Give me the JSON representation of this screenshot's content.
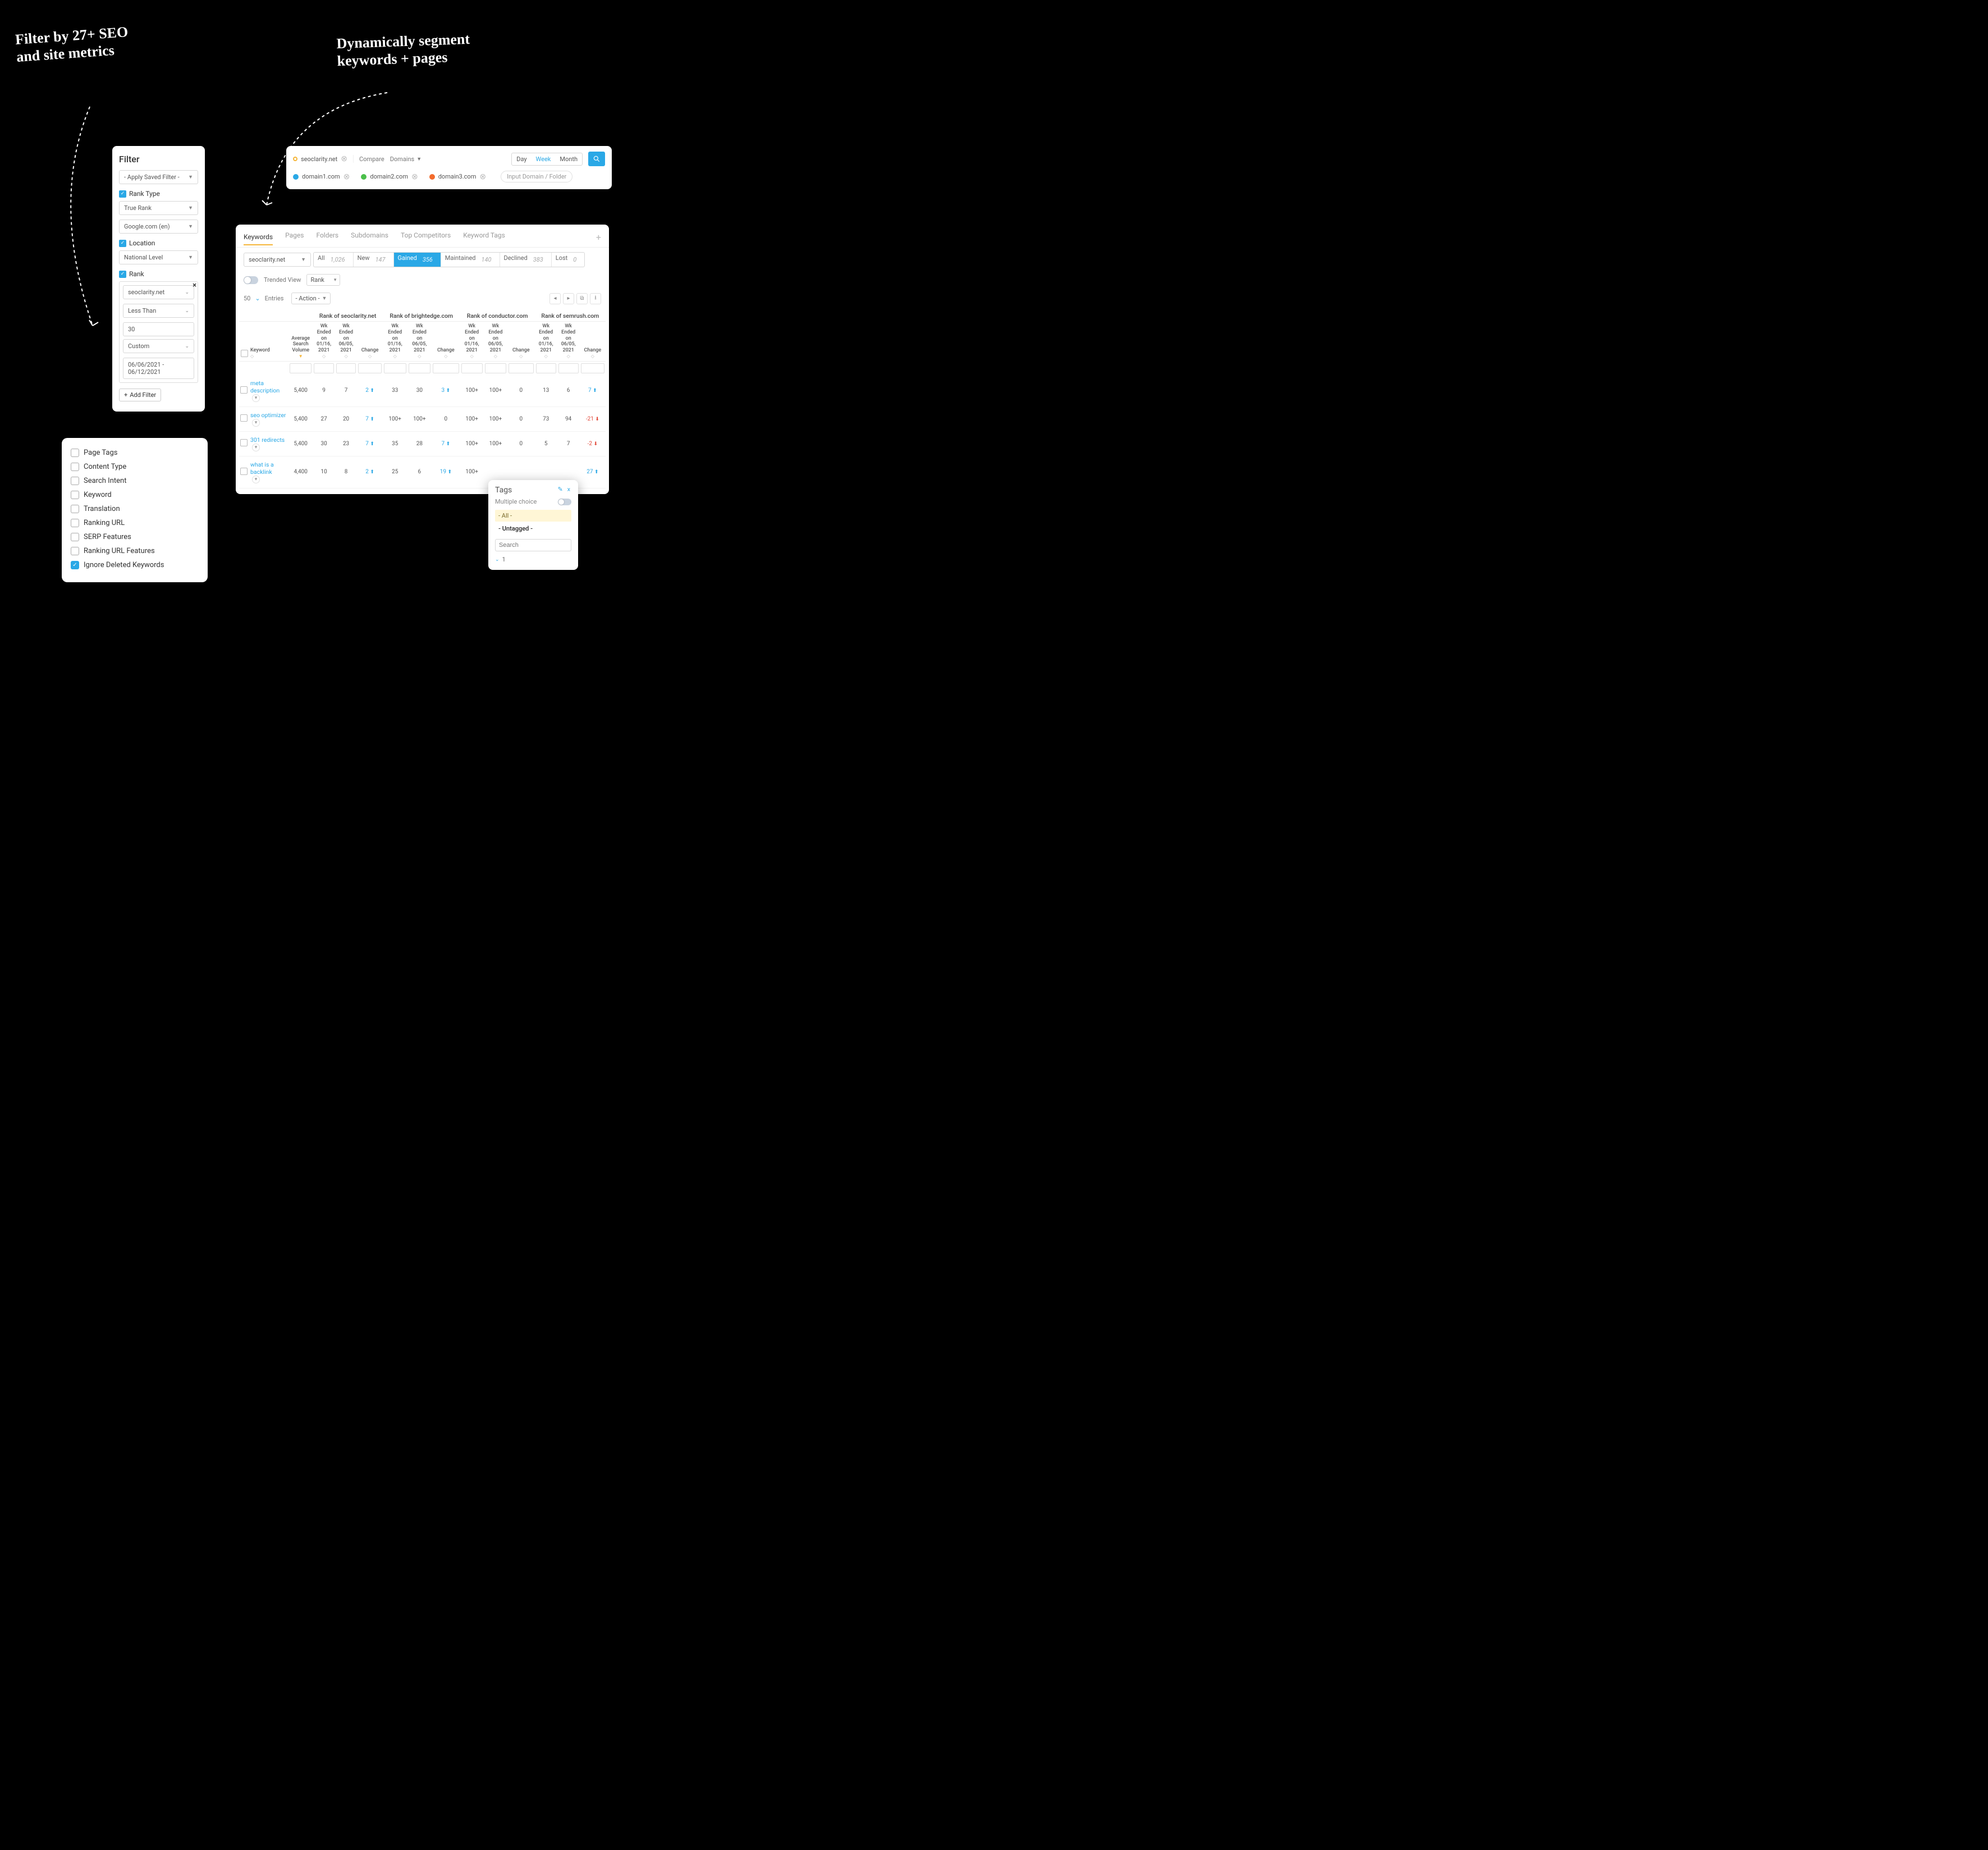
{
  "annotations": {
    "left": "Filter by 27+ SEO\nand site metrics",
    "right": "Dynamically segment\nkeywords + pages"
  },
  "filter_panel": {
    "title": "Filter",
    "apply_saved": "- Apply Saved Filter -",
    "rank_type_label": "Rank Type",
    "rank_type_value": "True Rank",
    "engine_value": "Google.com (en)",
    "location_label": "Location",
    "location_value": "National Level",
    "rank_label": "Rank",
    "rank_domain": "seoclarity.net",
    "rank_op": "Less Than",
    "rank_value": "30",
    "rank_range_type": "Custom",
    "rank_daterange": "06/06/2021 - 06/12/2021",
    "add_filter": "Add Filter"
  },
  "checklist": {
    "items": [
      {
        "label": "Page Tags",
        "checked": false
      },
      {
        "label": "Content Type",
        "checked": false
      },
      {
        "label": "Search Intent",
        "checked": false
      },
      {
        "label": "Keyword",
        "checked": false
      },
      {
        "label": "Translation",
        "checked": false
      },
      {
        "label": "Ranking URL",
        "checked": false
      },
      {
        "label": "SERP Features",
        "checked": false
      },
      {
        "label": "Ranking URL Features",
        "checked": false
      },
      {
        "label": "Ignore Deleted Keywords",
        "checked": true
      }
    ]
  },
  "searchbar": {
    "primary_domain": "seoclarity.net",
    "compare_label": "Compare",
    "domains_label": "Domains",
    "time": {
      "day": "Day",
      "week": "Week",
      "month": "Month"
    },
    "compare_domains": [
      {
        "name": "domain1.com",
        "color": "#2aa8e6"
      },
      {
        "name": "domain2.com",
        "color": "#4bbf4b"
      },
      {
        "name": "domain3.com",
        "color": "#f36b2c"
      }
    ],
    "input_placeholder": "Input Domain / Folder"
  },
  "results": {
    "tabs": [
      "Keywords",
      "Pages",
      "Folders",
      "Subdomains",
      "Top Competitors",
      "Keyword Tags"
    ],
    "active_tab": 0,
    "domain_select": "seoclarity.net",
    "status_pills": [
      {
        "label": "All",
        "count": "1,026"
      },
      {
        "label": "New",
        "count": "147"
      },
      {
        "label": "Gained",
        "count": "356"
      },
      {
        "label": "Maintained",
        "count": "140"
      },
      {
        "label": "Declined",
        "count": "383"
      },
      {
        "label": "Lost",
        "count": "0"
      }
    ],
    "active_pill": 2,
    "trended_label": "Trended View",
    "rank_select": "Rank",
    "entries_count": "50",
    "entries_label": "Entries",
    "action_label": "- Action -",
    "group_headers": [
      "Rank of seoclarity.net",
      "Rank of brightedge.com",
      "Rank of conductor.com",
      "Rank of semrush.com"
    ],
    "kw_header": "Keyword",
    "avg_header": "Average\nSearch\nVolume",
    "wk1_header": "Wk\nEnded\non\n01/16,\n2021",
    "wk2_header": "Wk\nEnded\non\n06/05,\n2021",
    "change_header": "Change",
    "rows": [
      {
        "kw": "meta description",
        "vol": "5,400",
        "a1": "9",
        "a2": "7",
        "ac": "2",
        "acd": "up",
        "b1": "33",
        "b2": "30",
        "bc": "3",
        "bcd": "up",
        "c1": "100+",
        "c2": "100+",
        "cc": "0",
        "ccd": "",
        "d1": "13",
        "d2": "6",
        "dc": "7",
        "dcd": "up"
      },
      {
        "kw": "seo optimizer",
        "vol": "5,400",
        "a1": "27",
        "a2": "20",
        "ac": "7",
        "acd": "up",
        "b1": "100+",
        "b2": "100+",
        "bc": "0",
        "bcd": "",
        "c1": "100+",
        "c2": "100+",
        "cc": "0",
        "ccd": "",
        "d1": "73",
        "d2": "94",
        "dc": "-21",
        "dcd": "down"
      },
      {
        "kw": "301 redirects",
        "vol": "5,400",
        "a1": "30",
        "a2": "23",
        "ac": "7",
        "acd": "up",
        "b1": "35",
        "b2": "28",
        "bc": "7",
        "bcd": "up",
        "c1": "100+",
        "c2": "100+",
        "cc": "0",
        "ccd": "",
        "d1": "5",
        "d2": "7",
        "dc": "-2",
        "dcd": "down"
      },
      {
        "kw": "what is a backlink",
        "vol": "4,400",
        "a1": "10",
        "a2": "8",
        "ac": "2",
        "acd": "up",
        "b1": "25",
        "b2": "6",
        "bc": "19",
        "bcd": "up",
        "c1": "100+",
        "c2": "",
        "cc": "",
        "ccd": "",
        "d1": "",
        "d2": "",
        "dc": "27",
        "dcd": "up"
      }
    ]
  },
  "tags": {
    "title": "Tags",
    "multiple_choice": "Multiple choice",
    "all": "- All -",
    "untagged": "- Untagged -",
    "search_placeholder": "Search",
    "count": "1"
  }
}
